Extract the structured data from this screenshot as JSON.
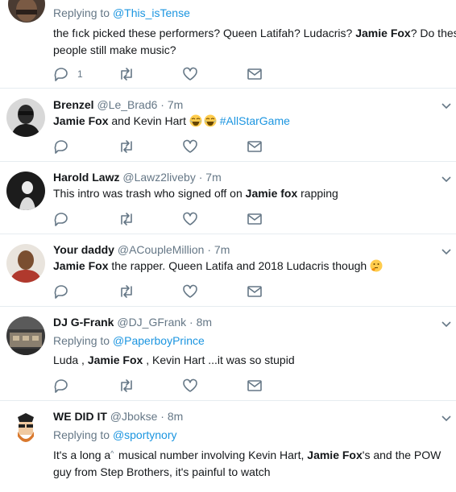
{
  "tweets": [
    {
      "reply_prefix": "Replying to ",
      "reply_to": "@This_isTense",
      "line1_a": "the f",
      "line1_b": "ck picked these performers? Queen Latifah? Ludacris?  ",
      "line1_bold": "Jamie Fox",
      "line1_c": "? Do these",
      "line2": "people still make music?",
      "reply_count": "1"
    },
    {
      "name": "Brenzel",
      "handle": "@Le_Brad6",
      "sep": " · ",
      "time": "7m",
      "bold": "Jamie Fox",
      "text": " and Kevin Hart ",
      "hashtag": "#AllStarGame"
    },
    {
      "name": "Harold Lawz",
      "handle": "@Lawz2liveby",
      "sep": " · ",
      "time": "7m",
      "text_a": "This intro was trash who signed off on ",
      "bold": "Jamie fox",
      "text_b": " rapping"
    },
    {
      "name": "Your daddy",
      "handle": "@ACoupleMillion",
      "sep": " · ",
      "time": "7m",
      "bold": "Jamie Fox",
      "text": " the rapper. Queen Latifa and 2018 Ludacris though "
    },
    {
      "name": "DJ G-Frank",
      "handle": "@DJ_GFrank",
      "sep": " · ",
      "time": "8m",
      "reply_prefix": "Replying to ",
      "reply_to": "@PaperboyPrince",
      "text_a": "Luda , ",
      "bold": "Jamie Fox",
      "text_b": " ,  Kevin Hart ...it was so stupid"
    },
    {
      "name": "WE DID IT",
      "handle": "@Jbokse",
      "sep": " · ",
      "time": "8m",
      "reply_prefix": "Replying to ",
      "reply_to": "@sportynory",
      "line1_a": "It's a long a",
      "line1_b": " musical number involving Kevin Hart, ",
      "line1_bold": "Jamie Fox",
      "line1_c": "'s and the POW",
      "line2": "guy from Step Brothers, it's painful to watch"
    }
  ],
  "icons": {
    "reply": "reply-icon",
    "retweet": "retweet-icon",
    "like": "heart-icon",
    "dm": "envelope-icon",
    "caret": "chevron-down-icon"
  },
  "colors": {
    "link": "#1b95e0",
    "muted": "#657786",
    "text": "#14171a",
    "divider": "#e6ecf0"
  }
}
